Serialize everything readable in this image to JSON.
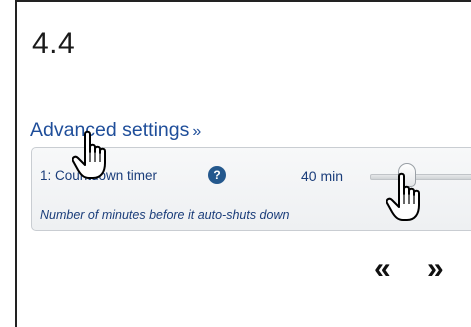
{
  "step": {
    "number": "4.4"
  },
  "advanced": {
    "link_text": "Advanced settings",
    "link_arrows": "»"
  },
  "setting": {
    "label": "1: Countdown timer",
    "help_icon": "question-circle-icon",
    "help_glyph": "?",
    "value": "40 min",
    "description": "Number of minutes before it auto-shuts down"
  },
  "navigation": {
    "prev_label": "«",
    "next_label": "»"
  },
  "cursors": [
    "hand-pointer-icon",
    "hand-pointer-icon"
  ],
  "colors": {
    "link": "#1f4e9a",
    "help_icon": "#24588d",
    "text": "#1a3d7a"
  }
}
